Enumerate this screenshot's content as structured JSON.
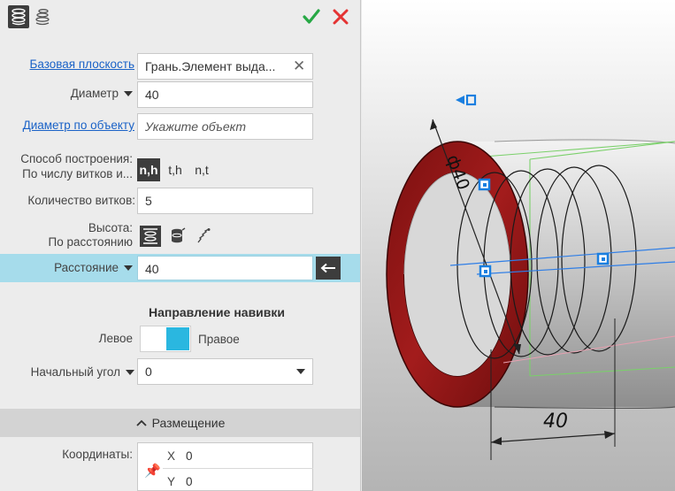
{
  "header": {
    "tab1_icon": "helix-icon",
    "tab2_icon": "spiral-helix-icon",
    "ok_icon": "check-icon",
    "cancel_icon": "close-icon"
  },
  "form": {
    "base_plane": {
      "label": "Базовая плоскость",
      "value": "Грань.Элемент выда..."
    },
    "diameter": {
      "label": "Диаметр",
      "value": "40"
    },
    "diameter_by_object": {
      "label": "Диаметр по объекту",
      "placeholder": "Укажите объект"
    },
    "construction_method": {
      "label": "Способ построения:",
      "sublabel": "По числу витков и...",
      "options": [
        "n,h",
        "t,h",
        "n,t"
      ],
      "selected": "n,h"
    },
    "turns": {
      "label": "Количество витков:",
      "value": "5"
    },
    "height": {
      "label": "Высота:",
      "sublabel": "По расстоянию"
    },
    "distance": {
      "label": "Расстояние",
      "value": "40"
    },
    "winding_direction": {
      "title": "Направление навивки",
      "left": "Левое",
      "right": "Правое",
      "selected": "Правое"
    },
    "start_angle": {
      "label": "Начальный угол",
      "value": "0"
    },
    "placement": {
      "title": "Размещение"
    },
    "coordinates": {
      "label": "Координаты:",
      "x_label": "X",
      "x": "0",
      "y_label": "Y",
      "y": "0"
    }
  },
  "viewport": {
    "dim_length": "40",
    "dim_diameter": "ф40"
  },
  "colors": {
    "accent": "#2ab7e0",
    "highlight_row": "#a6dceb",
    "link": "#1a62c7",
    "ok": "#27a845",
    "cancel": "#e43333",
    "ring": "#8e1515"
  }
}
